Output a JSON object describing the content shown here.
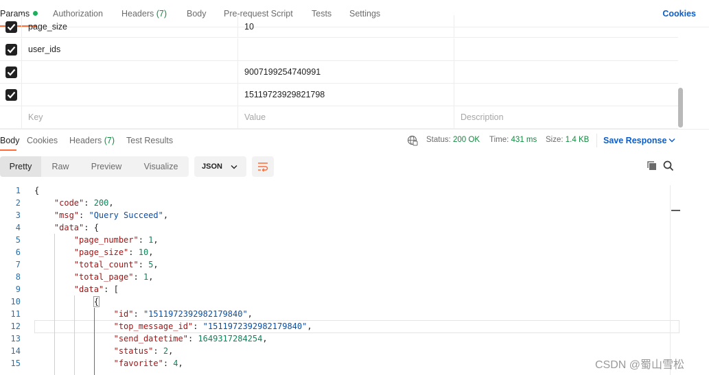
{
  "request_tabs": {
    "params": "Params",
    "authorization": "Authorization",
    "headers": "Headers",
    "headers_count": "(7)",
    "body": "Body",
    "pre_request": "Pre-request Script",
    "tests": "Tests",
    "settings": "Settings",
    "cookies": "Cookies"
  },
  "params": [
    {
      "checked": true,
      "key": "page_size",
      "value": "10",
      "description": ""
    },
    {
      "checked": true,
      "key": "user_ids",
      "value": "",
      "description": ""
    },
    {
      "checked": true,
      "key": "",
      "value": "9007199254740991",
      "description": ""
    },
    {
      "checked": true,
      "key": "",
      "value": "15119723929821798",
      "description": ""
    }
  ],
  "params_placeholder": {
    "key": "Key",
    "value": "Value",
    "description": "Description"
  },
  "response_tabs": {
    "body": "Body",
    "cookies": "Cookies",
    "headers": "Headers",
    "headers_count": "(7)",
    "test_results": "Test Results"
  },
  "response_meta": {
    "status_label": "Status:",
    "status_value": "200 OK",
    "time_label": "Time:",
    "time_value": "431 ms",
    "size_label": "Size:",
    "size_value": "1.4 KB",
    "save_response": "Save Response"
  },
  "view_modes": [
    "Pretty",
    "Raw",
    "Preview",
    "Visualize"
  ],
  "format": "JSON",
  "icons": [
    "globe-icon",
    "chevron-down-icon",
    "wrap-lines-icon",
    "copy-icon",
    "search-icon",
    "checkbox-checked-icon"
  ],
  "colors": {
    "accent": "#ff6c37",
    "link": "#0b5dc9",
    "success": "#0f8a3e"
  },
  "code_lines": [
    {
      "n": "1",
      "parts": [
        [
          "p",
          "{"
        ]
      ]
    },
    {
      "n": "2",
      "parts": [
        [
          "p",
          "    "
        ],
        [
          "k",
          "\"code\""
        ],
        [
          "p",
          ": "
        ],
        [
          "n",
          "200"
        ],
        [
          "p",
          ","
        ]
      ]
    },
    {
      "n": "3",
      "parts": [
        [
          "p",
          "    "
        ],
        [
          "k",
          "\"msg\""
        ],
        [
          "p",
          ": "
        ],
        [
          "s",
          "\"Query Succeed\""
        ],
        [
          "p",
          ","
        ]
      ]
    },
    {
      "n": "4",
      "parts": [
        [
          "p",
          "    "
        ],
        [
          "k",
          "\"data\""
        ],
        [
          "p",
          ": {"
        ]
      ]
    },
    {
      "n": "5",
      "parts": [
        [
          "p",
          "        "
        ],
        [
          "k",
          "\"page_number\""
        ],
        [
          "p",
          ": "
        ],
        [
          "n",
          "1"
        ],
        [
          "p",
          ","
        ]
      ]
    },
    {
      "n": "6",
      "parts": [
        [
          "p",
          "        "
        ],
        [
          "k",
          "\"page_size\""
        ],
        [
          "p",
          ": "
        ],
        [
          "n",
          "10"
        ],
        [
          "p",
          ","
        ]
      ]
    },
    {
      "n": "7",
      "parts": [
        [
          "p",
          "        "
        ],
        [
          "k",
          "\"total_count\""
        ],
        [
          "p",
          ": "
        ],
        [
          "n",
          "5"
        ],
        [
          "p",
          ","
        ]
      ]
    },
    {
      "n": "8",
      "parts": [
        [
          "p",
          "        "
        ],
        [
          "k",
          "\"total_page\""
        ],
        [
          "p",
          ": "
        ],
        [
          "n",
          "1"
        ],
        [
          "p",
          ","
        ]
      ]
    },
    {
      "n": "9",
      "parts": [
        [
          "p",
          "        "
        ],
        [
          "k",
          "\"data\""
        ],
        [
          "p",
          ": ["
        ]
      ]
    },
    {
      "n": "10",
      "parts": [
        [
          "p",
          "            "
        ],
        [
          "b",
          "{"
        ]
      ]
    },
    {
      "n": "11",
      "parts": [
        [
          "p",
          "                "
        ],
        [
          "k",
          "\"id\""
        ],
        [
          "p",
          ": "
        ],
        [
          "s",
          "\"1511972392982179840\""
        ],
        [
          "p",
          ","
        ]
      ]
    },
    {
      "n": "12",
      "parts": [
        [
          "p",
          "                "
        ],
        [
          "k",
          "\"top_message_id\""
        ],
        [
          "p",
          ": "
        ],
        [
          "s",
          "\"1511972392982179840\""
        ],
        [
          "p",
          ","
        ]
      ]
    },
    {
      "n": "13",
      "parts": [
        [
          "p",
          "                "
        ],
        [
          "k",
          "\"send_datetime\""
        ],
        [
          "p",
          ": "
        ],
        [
          "n",
          "1649317284254"
        ],
        [
          "p",
          ","
        ]
      ]
    },
    {
      "n": "14",
      "parts": [
        [
          "p",
          "                "
        ],
        [
          "k",
          "\"status\""
        ],
        [
          "p",
          ": "
        ],
        [
          "n",
          "2"
        ],
        [
          "p",
          ","
        ]
      ]
    },
    {
      "n": "15",
      "parts": [
        [
          "p",
          "                "
        ],
        [
          "k",
          "\"favorite\""
        ],
        [
          "p",
          ": "
        ],
        [
          "n",
          "4"
        ],
        [
          "p",
          ","
        ]
      ]
    }
  ],
  "watermark": "CSDN @蜀山雪松"
}
